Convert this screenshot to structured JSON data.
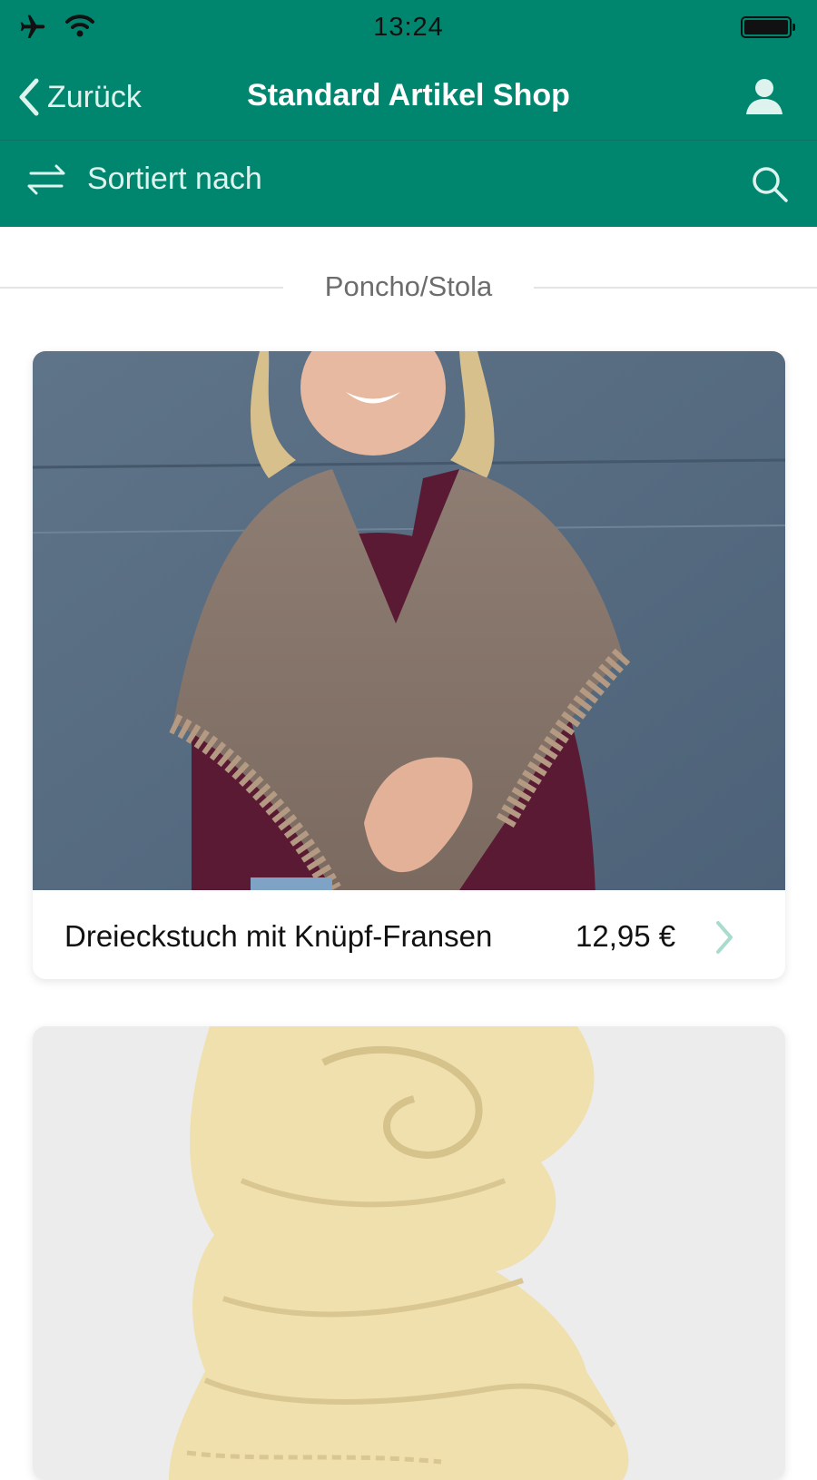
{
  "status_bar": {
    "time": "13:24"
  },
  "nav": {
    "back_label": "Zurück",
    "title": "Standard Artikel Shop"
  },
  "toolbar": {
    "sort_label": "Sortiert nach"
  },
  "section": {
    "label": "Poncho/Stola"
  },
  "products": [
    {
      "name": "Dreieckstuch mit Knüpf-Fransen",
      "price": "12,95 €"
    }
  ],
  "colors": {
    "header": "#00866f",
    "accent_light": "#dff3ee"
  }
}
